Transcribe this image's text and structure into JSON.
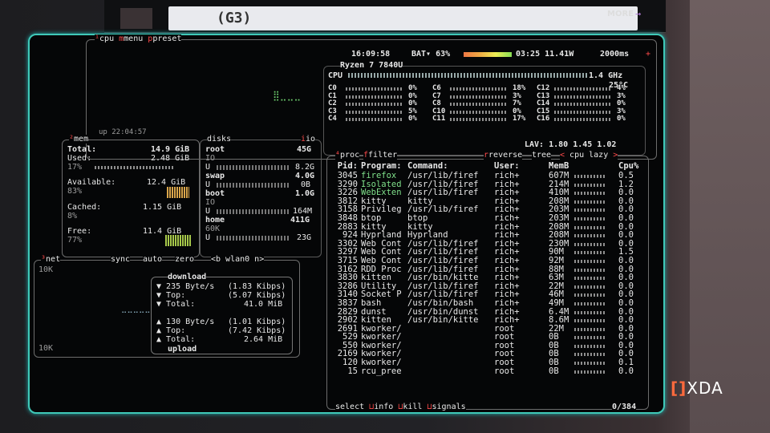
{
  "website": {
    "more_label": "MORE",
    "thumb_text": "(G3)"
  },
  "watermark": {
    "bracket": "[]",
    "text": "XDA"
  },
  "cpu": {
    "tab_labels": [
      "cpu",
      "menu",
      "preset"
    ],
    "clock": "16:09:58",
    "battery_label": "BAT▾ 63%",
    "battery_extra": "03:25 11.41W",
    "refresh": "2000ms",
    "model": "Ryzen 7 7840U",
    "freq": "1.4 GHz",
    "temp": "25°C",
    "uptime": "up 22:04:57",
    "lav": "LAV: 1.80 1.45 1.02",
    "cores": [
      {
        "name": "C0",
        "pct": "0%"
      },
      {
        "name": "C1",
        "pct": "0%"
      },
      {
        "name": "C2",
        "pct": "0%"
      },
      {
        "name": "C3",
        "pct": "5%"
      },
      {
        "name": "C4",
        "pct": "0%"
      },
      {
        "name": "C6",
        "pct": "18%"
      },
      {
        "name": "C7",
        "pct": "3%"
      },
      {
        "name": "C8",
        "pct": "7%"
      },
      {
        "name": "C10",
        "pct": "0%"
      },
      {
        "name": "C11",
        "pct": "17%"
      },
      {
        "name": "C12",
        "pct": "4%"
      },
      {
        "name": "C13",
        "pct": "3%"
      },
      {
        "name": "C14",
        "pct": "0%"
      },
      {
        "name": "C15",
        "pct": "3%"
      },
      {
        "name": "C16",
        "pct": "0%"
      }
    ]
  },
  "mem": {
    "title": "mem",
    "total_label": "Total:",
    "total_val": "14.9 GiB",
    "used_label": "Used:",
    "used_val": "2.48 GiB",
    "used_pct": "17%",
    "avail_label": "Available:",
    "avail_val": "12.4 GiB",
    "avail_pct": "83%",
    "cached_label": "Cached:",
    "cached_val": "1.15 GiB",
    "cached_pct": "8%",
    "free_label": "Free:",
    "free_val": "11.4 GiB",
    "free_pct": "77%"
  },
  "disks": {
    "title": "disks",
    "io_label": "io",
    "root_name": "root",
    "root_val": "45G",
    "root_io": "IO",
    "root_u": "U",
    "root_used": "8.2G",
    "swap_name": "swap",
    "swap_val": "4.0G",
    "swap_u": "U",
    "swap_used": "0B",
    "boot_name": "boot",
    "boot_val": "1.0G",
    "boot_io": "IO",
    "boot_u": "U",
    "boot_used": "164M",
    "home_name": "home",
    "home_val": "411G",
    "home_io": "60K",
    "home_u": "U",
    "home_used": "23G"
  },
  "net": {
    "title": "net",
    "sync": "sync",
    "auto": "auto",
    "zero": "zero",
    "iface": "<b wlan0 n>",
    "scale_top": "10K",
    "scale_bottom": "10K",
    "download_label": "download",
    "dl_rate": "235 Byte/s",
    "dl_rate_bits": "(1.83 Kibps)",
    "dl_top_label": "Top:",
    "dl_top": "(5.07 Kibps)",
    "dl_total_label": "Total:",
    "dl_total": "41.0 MiB",
    "ul_rate": "130 Byte/s",
    "ul_rate_bits": "(1.01 Kibps)",
    "ul_top_label": "Top:",
    "ul_top": "(7.42 Kibps)",
    "ul_total_label": "Total:",
    "ul_total": "2.64 MiB",
    "upload_label": "upload"
  },
  "proc": {
    "title": "proc",
    "filter": "filter",
    "reverse": "reverse",
    "tree": "tree",
    "sort": "cpu lazy",
    "headers": {
      "pid": "Pid:",
      "program": "Program:",
      "command": "Command:",
      "user": "User:",
      "mem": "MemB",
      "cpu": "Cpu%"
    },
    "rows": [
      {
        "pid": "3045",
        "program": "firefox",
        "command": "/usr/lib/firef",
        "user": "rich+",
        "mem": "607M",
        "cpu": "0.5"
      },
      {
        "pid": "3290",
        "program": "Isolated",
        "command": "/usr/lib/firef",
        "user": "rich+",
        "mem": "214M",
        "cpu": "1.2"
      },
      {
        "pid": "3226",
        "program": "WebExten",
        "command": "/usr/lib/firef",
        "user": "rich+",
        "mem": "410M",
        "cpu": "0.0"
      },
      {
        "pid": "3812",
        "program": "kitty",
        "command": "kitty",
        "user": "rich+",
        "mem": "208M",
        "cpu": "0.0"
      },
      {
        "pid": "3158",
        "program": "Privileg",
        "command": "/usr/lib/firef",
        "user": "rich+",
        "mem": "203M",
        "cpu": "0.0"
      },
      {
        "pid": "3848",
        "program": "btop",
        "command": "btop",
        "user": "rich+",
        "mem": "203M",
        "cpu": "0.0"
      },
      {
        "pid": "2883",
        "program": "kitty",
        "command": "kitty",
        "user": "rich+",
        "mem": "208M",
        "cpu": "0.0"
      },
      {
        "pid": "924",
        "program": "Hyprland",
        "command": "Hyprland",
        "user": "rich+",
        "mem": "208M",
        "cpu": "0.0"
      },
      {
        "pid": "3302",
        "program": "Web Cont",
        "command": "/usr/lib/firef",
        "user": "rich+",
        "mem": "230M",
        "cpu": "0.0"
      },
      {
        "pid": "3297",
        "program": "Web Cont",
        "command": "/usr/lib/firef",
        "user": "rich+",
        "mem": "90M",
        "cpu": "1.5"
      },
      {
        "pid": "3715",
        "program": "Web Cont",
        "command": "/usr/lib/firef",
        "user": "rich+",
        "mem": "92M",
        "cpu": "0.0"
      },
      {
        "pid": "3162",
        "program": "RDD Proc",
        "command": "/usr/lib/firef",
        "user": "rich+",
        "mem": "88M",
        "cpu": "0.0"
      },
      {
        "pid": "3830",
        "program": "kitten",
        "command": "/usr/bin/kitte",
        "user": "rich+",
        "mem": "63M",
        "cpu": "0.0"
      },
      {
        "pid": "3286",
        "program": "Utility",
        "command": "/usr/lib/firef",
        "user": "rich+",
        "mem": "22M",
        "cpu": "0.0"
      },
      {
        "pid": "3140",
        "program": "Socket P",
        "command": "/usr/lib/firef",
        "user": "rich+",
        "mem": "46M",
        "cpu": "0.0"
      },
      {
        "pid": "3837",
        "program": "bash",
        "command": "/usr/bin/bash",
        "user": "rich+",
        "mem": "49M",
        "cpu": "0.0"
      },
      {
        "pid": "2829",
        "program": "dunst",
        "command": "/usr/bin/dunst",
        "user": "rich+",
        "mem": "6.4M",
        "cpu": "0.0"
      },
      {
        "pid": "2902",
        "program": "kitten",
        "command": "/usr/bin/kitte",
        "user": "rich+",
        "mem": "8.6M",
        "cpu": "0.0"
      },
      {
        "pid": "2691",
        "program": "kworker/",
        "command": "",
        "user": "root",
        "mem": "22M",
        "cpu": "0.0"
      },
      {
        "pid": "529",
        "program": "kworker/",
        "command": "",
        "user": "root",
        "mem": "0B",
        "cpu": "0.0"
      },
      {
        "pid": "550",
        "program": "kworker/",
        "command": "",
        "user": "root",
        "mem": "0B",
        "cpu": "0.0"
      },
      {
        "pid": "2169",
        "program": "kworker/",
        "command": "",
        "user": "root",
        "mem": "0B",
        "cpu": "0.0"
      },
      {
        "pid": "120",
        "program": "kworker/",
        "command": "",
        "user": "root",
        "mem": "0B",
        "cpu": "0.1"
      },
      {
        "pid": "15",
        "program": "rcu_pree",
        "command": "",
        "user": "root",
        "mem": "0B",
        "cpu": "0.0"
      }
    ],
    "footer_select": "select",
    "footer_info": "info",
    "footer_kill": "kill",
    "footer_signals": "signals",
    "count": "0/384"
  }
}
